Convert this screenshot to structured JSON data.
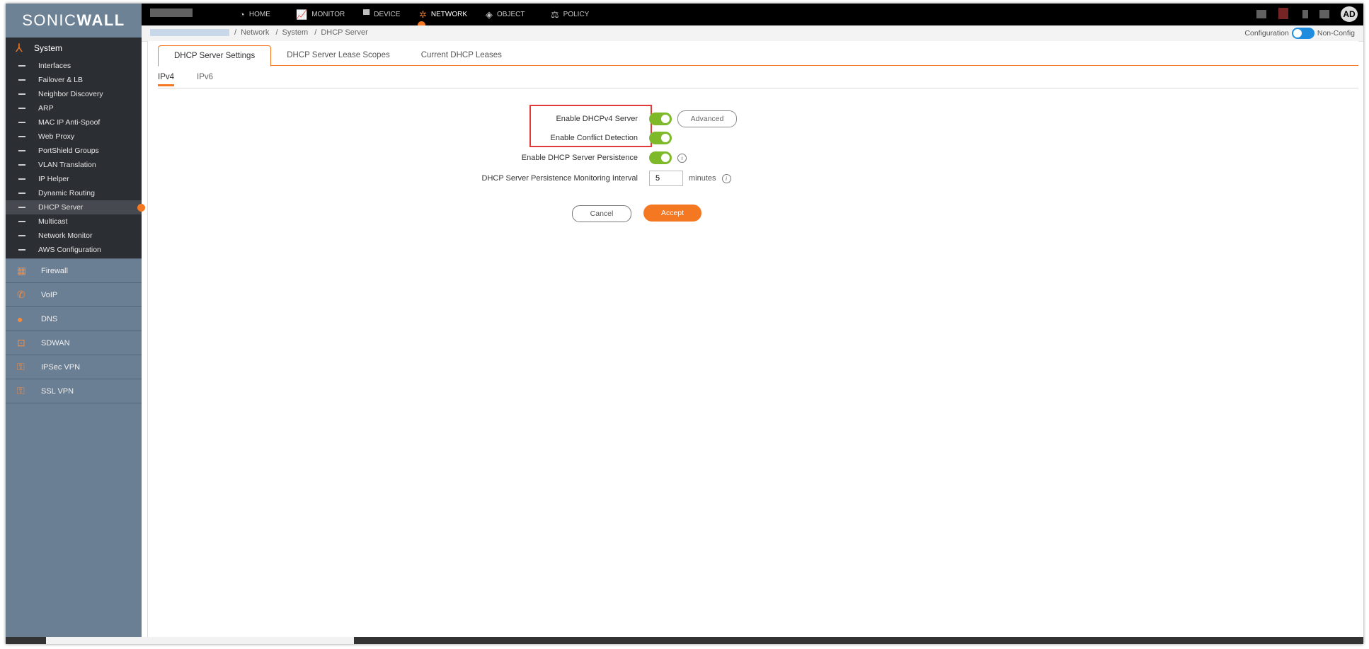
{
  "logo": {
    "text_light": "SONIC",
    "text_bold": "WALL"
  },
  "topnav": {
    "items": [
      {
        "label": "HOME",
        "icon": "dashboard-icon"
      },
      {
        "label": "MONITOR",
        "icon": "chart-icon"
      },
      {
        "label": "DEVICE",
        "icon": "monitor-icon"
      },
      {
        "label": "NETWORK",
        "icon": "network-icon",
        "active": true
      },
      {
        "label": "OBJECT",
        "icon": "object-icon"
      },
      {
        "label": "POLICY",
        "icon": "policy-icon"
      }
    ],
    "avatar": "AD"
  },
  "breadcrumb": {
    "items": [
      "Network",
      "System",
      "DHCP Server"
    ]
  },
  "mode": {
    "left": "Configuration",
    "right": "Non-Config"
  },
  "sidebar": {
    "system": {
      "label": "System",
      "items": [
        {
          "label": "Interfaces"
        },
        {
          "label": "Failover & LB"
        },
        {
          "label": "Neighbor Discovery"
        },
        {
          "label": "ARP"
        },
        {
          "label": "MAC IP Anti-Spoof"
        },
        {
          "label": "Web Proxy"
        },
        {
          "label": "PortShield Groups"
        },
        {
          "label": "VLAN Translation"
        },
        {
          "label": "IP Helper"
        },
        {
          "label": "Dynamic Routing"
        },
        {
          "label": "DHCP Server",
          "active": true
        },
        {
          "label": "Multicast"
        },
        {
          "label": "Network Monitor"
        },
        {
          "label": "AWS Configuration"
        }
      ]
    },
    "groups": [
      {
        "label": "Firewall",
        "icon": "firewall-icon"
      },
      {
        "label": "VoIP",
        "icon": "phone-icon"
      },
      {
        "label": "DNS",
        "icon": "globe-icon"
      },
      {
        "label": "SDWAN",
        "icon": "sdwan-icon"
      },
      {
        "label": "IPSec VPN",
        "icon": "vpn-icon"
      },
      {
        "label": "SSL VPN",
        "icon": "ssl-vpn-icon"
      }
    ]
  },
  "tabs": [
    "DHCP Server Settings",
    "DHCP Server Lease Scopes",
    "Current DHCP Leases"
  ],
  "subtabs": [
    "IPv4",
    "IPv6"
  ],
  "form": {
    "enable_dhcpv4": {
      "label": "Enable DHCPv4 Server",
      "on": true
    },
    "advanced_label": "Advanced",
    "conflict_detection": {
      "label": "Enable Conflict Detection",
      "on": true
    },
    "persistence": {
      "label": "Enable DHCP Server Persistence",
      "on": true
    },
    "interval": {
      "label": "DHCP Server Persistence Monitoring Interval",
      "value": "5",
      "unit": "minutes"
    },
    "cancel_label": "Cancel",
    "accept_label": "Accept"
  },
  "colors": {
    "accent": "#f47721",
    "toggle_on": "#7db928",
    "highlight": "#e03a3a"
  }
}
